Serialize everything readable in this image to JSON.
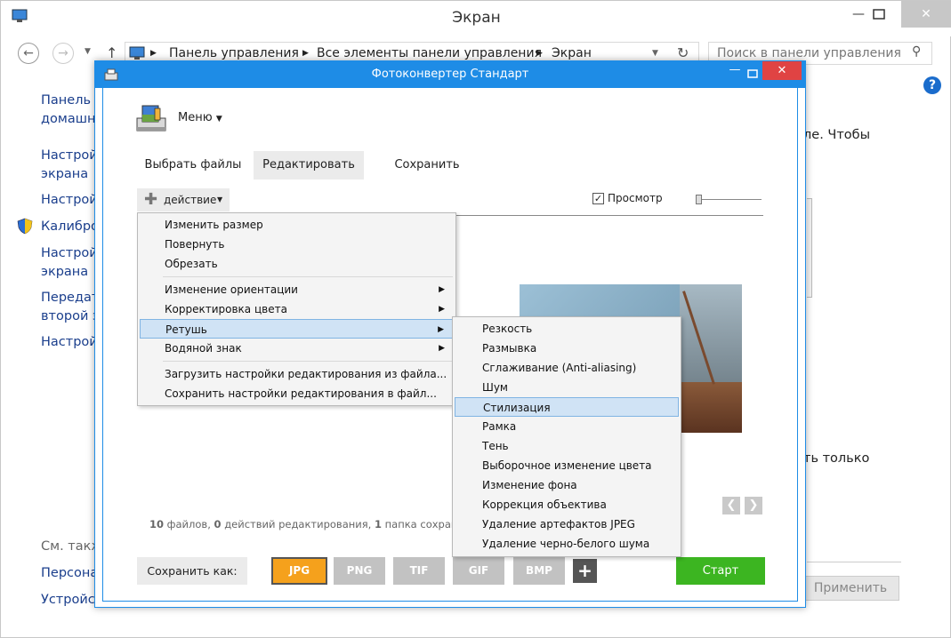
{
  "outer": {
    "title": "Экран",
    "breadcrumb": [
      "Панель управления",
      "Все элементы панели управления",
      "Экран"
    ],
    "search_placeholder": "Поиск в панели управления",
    "left_links": [
      "Панель у",
      "домашня",
      "Настрой",
      "экрана",
      "Настрой",
      "Калибро",
      "Настрой",
      "экрана",
      "Передат",
      "второй э",
      "Настрой"
    ],
    "see_also": "См. такж",
    "bottom_links": [
      "Персона",
      "Устройст"
    ],
    "right_text_1": "ле. Чтобы",
    "right_text_2": "ть только",
    "apply_button": "Применить"
  },
  "app": {
    "title": "Фотоконвертер Стандарт",
    "menu_label": "Меню",
    "tabs": [
      "Выбрать файлы",
      "Редактировать",
      "Сохранить"
    ],
    "action_label": "действие",
    "preview_label": "Просмотр",
    "status": {
      "files_count": "10",
      "files_label": "файлов,",
      "actions_count": "0",
      "actions_label": "действий редактирования,",
      "folders_count": "1",
      "folders_label": "папка сохранения"
    },
    "save_as_label": "Сохранить как:",
    "formats": [
      "JPG",
      "PNG",
      "TIF",
      "GIF",
      "BMP"
    ],
    "add_format": "+",
    "start_button": "Старт"
  },
  "action_menu": [
    "Изменить размер",
    "Повернуть",
    "Обрезать",
    "Изменение ориентации",
    "Корректировка цвета",
    "Ретушь",
    "Водяной знак",
    "Загрузить настройки редактирования из файла...",
    "Сохранить настройки редактирования в файл..."
  ],
  "retouch_submenu": [
    "Резкость",
    "Размывка",
    "Сглаживание (Anti-aliasing)",
    "Шум",
    "Стилизация",
    "Рамка",
    "Тень",
    "Выборочное изменение цвета",
    "Изменение фона",
    "Коррекция объектива",
    "Удаление артефактов JPEG",
    "Удаление черно-белого шума"
  ],
  "colors": {
    "accent": "#1e8ce6",
    "selected_format": "#f5a11c",
    "inactive_format": "#c2c2c2",
    "start": "#3cb521",
    "highlight": "#d0e3f5"
  }
}
